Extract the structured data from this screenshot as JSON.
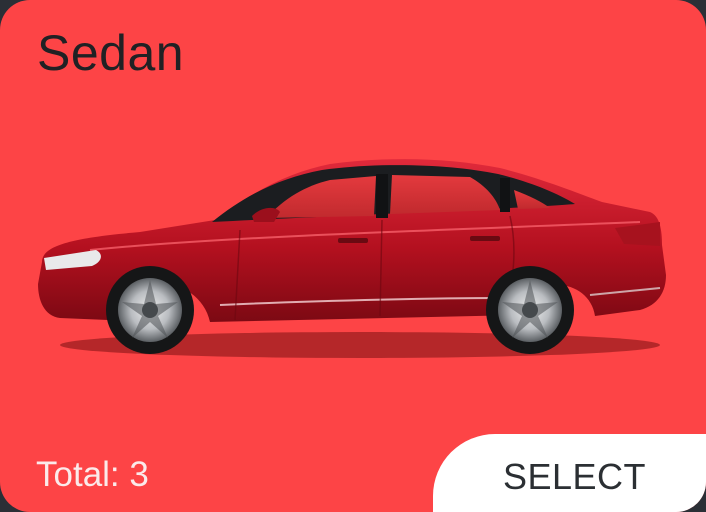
{
  "card": {
    "title": "Sedan",
    "total_label": "Total: 3",
    "select_label": "SELECT",
    "background_color": "#fd4446",
    "car_image": "red-sedan-car-image"
  }
}
